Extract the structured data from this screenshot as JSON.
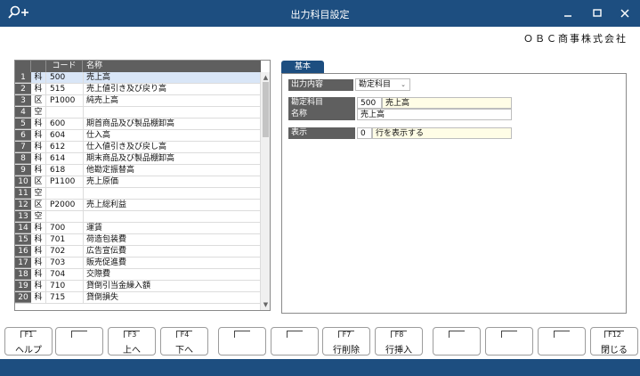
{
  "window": {
    "title": "出力科目設定",
    "company": "ＯＢＣ商事株式会社"
  },
  "grid": {
    "columns": {
      "num": "",
      "kubun": "",
      "code": "コード",
      "name": "名称"
    },
    "rows": [
      {
        "num": "1",
        "kubun": "科",
        "code": "500",
        "name": "売上高",
        "selected": true
      },
      {
        "num": "2",
        "kubun": "科",
        "code": "515",
        "name": "売上値引き及び戻り高"
      },
      {
        "num": "3",
        "kubun": "区",
        "code": "P1000",
        "name": "純売上高"
      },
      {
        "num": "4",
        "kubun": "空",
        "code": "",
        "name": ""
      },
      {
        "num": "5",
        "kubun": "科",
        "code": "600",
        "name": "期首商品及び製品棚卸高"
      },
      {
        "num": "6",
        "kubun": "科",
        "code": "604",
        "name": "仕入高"
      },
      {
        "num": "7",
        "kubun": "科",
        "code": "612",
        "name": "仕入値引き及び戻し高"
      },
      {
        "num": "8",
        "kubun": "科",
        "code": "614",
        "name": "期末商品及び製品棚卸高"
      },
      {
        "num": "9",
        "kubun": "科",
        "code": "618",
        "name": "他勘定振替高"
      },
      {
        "num": "10",
        "kubun": "区",
        "code": "P1100",
        "name": "売上原価"
      },
      {
        "num": "11",
        "kubun": "空",
        "code": "",
        "name": ""
      },
      {
        "num": "12",
        "kubun": "区",
        "code": "P2000",
        "name": "売上総利益"
      },
      {
        "num": "13",
        "kubun": "空",
        "code": "",
        "name": ""
      },
      {
        "num": "14",
        "kubun": "科",
        "code": "700",
        "name": "運賃"
      },
      {
        "num": "15",
        "kubun": "科",
        "code": "701",
        "name": "荷造包装費"
      },
      {
        "num": "16",
        "kubun": "科",
        "code": "702",
        "name": "広告宣伝費"
      },
      {
        "num": "17",
        "kubun": "科",
        "code": "703",
        "name": "販売促進費"
      },
      {
        "num": "18",
        "kubun": "科",
        "code": "704",
        "name": "交際費"
      },
      {
        "num": "19",
        "kubun": "科",
        "code": "710",
        "name": "貸倒引当金繰入額"
      },
      {
        "num": "20",
        "kubun": "科",
        "code": "715",
        "name": "貸倒損失"
      }
    ]
  },
  "panel": {
    "tab": "基本",
    "output": {
      "label": "出力内容",
      "value": "勘定科目"
    },
    "account": {
      "label": "勘定科目",
      "code": "500",
      "name": "売上高"
    },
    "name": {
      "label": "名称",
      "value": "売上高"
    },
    "display": {
      "label": "表示",
      "value": "0",
      "desc": "行を表示する"
    }
  },
  "fkeys": [
    {
      "key": "F1",
      "label": "ヘルプ"
    },
    {
      "key": "",
      "label": ""
    },
    {
      "key": "F3",
      "label": "上へ"
    },
    {
      "key": "F4",
      "label": "下へ"
    },
    {
      "key": "",
      "label": ""
    },
    {
      "key": "",
      "label": ""
    },
    {
      "key": "F7",
      "label": "行削除"
    },
    {
      "key": "F8",
      "label": "行挿入"
    },
    {
      "key": "",
      "label": ""
    },
    {
      "key": "",
      "label": ""
    },
    {
      "key": "",
      "label": ""
    },
    {
      "key": "F12",
      "label": "閉じる"
    }
  ]
}
